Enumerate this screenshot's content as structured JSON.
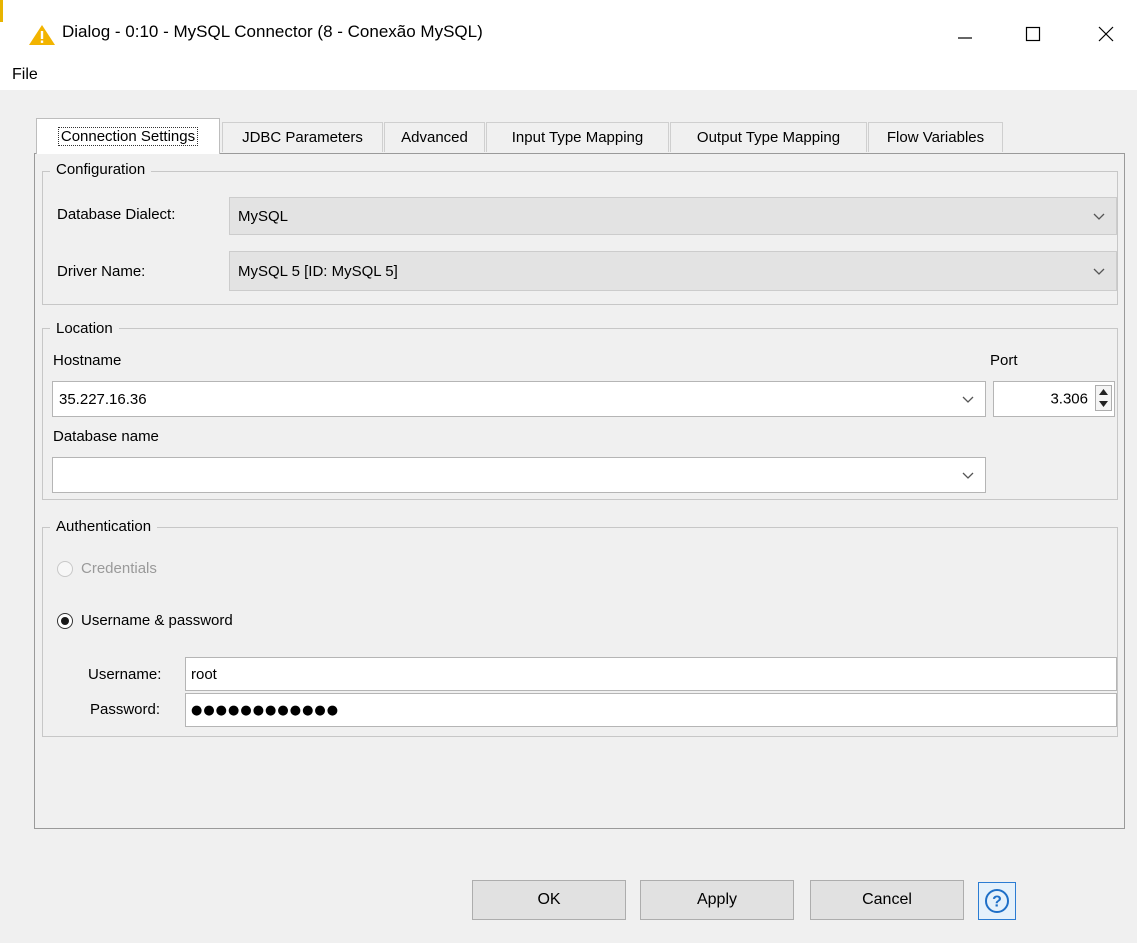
{
  "window": {
    "title": "Dialog - 0:10 - MySQL Connector (8 - Conexão MySQL)",
    "minimize_glyph": "—",
    "maximize_glyph": "☐",
    "close_glyph": "✕",
    "icon": "warning-triangle-icon",
    "accent_color": "#f2b400"
  },
  "menu": {
    "file": "File"
  },
  "tabs": [
    {
      "label": "Connection Settings",
      "active": true
    },
    {
      "label": "JDBC Parameters"
    },
    {
      "label": "Advanced"
    },
    {
      "label": "Input Type Mapping"
    },
    {
      "label": "Output Type Mapping"
    },
    {
      "label": "Flow Variables"
    }
  ],
  "configuration": {
    "legend": "Configuration",
    "dialect_label": "Database Dialect:",
    "dialect_value": "MySQL",
    "driver_label": "Driver Name:",
    "driver_value": "MySQL 5 [ID: MySQL 5]"
  },
  "location": {
    "legend": "Location",
    "hostname_label": "Hostname",
    "hostname_value": "35.227.16.36",
    "port_label": "Port",
    "port_value": "3.306",
    "dbname_label": "Database name",
    "dbname_value": ""
  },
  "authentication": {
    "legend": "Authentication",
    "credentials_label": "Credentials",
    "userpass_label": "Username & password",
    "username_label": "Username:",
    "username_value": "root",
    "password_label": "Password:",
    "password_value": "●●●●●●●●●●●●"
  },
  "buttons": {
    "ok": "OK",
    "apply": "Apply",
    "cancel": "Cancel",
    "help_glyph": "?"
  }
}
